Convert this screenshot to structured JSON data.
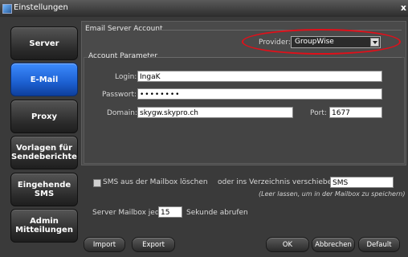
{
  "window": {
    "title": "Einstellungen",
    "close_label": "x"
  },
  "sidebar": {
    "items": [
      {
        "label": "Server"
      },
      {
        "label": "E-Mail"
      },
      {
        "label": "Proxy"
      },
      {
        "label": "Vorlagen für Sendeberichte"
      },
      {
        "label": "Eingehende SMS"
      },
      {
        "label": "Admin Mitteilungen"
      }
    ]
  },
  "email_server": {
    "group_title": "Email Server Account",
    "provider_label": "Provider:",
    "provider_value": "GroupWise",
    "highlight_color": "#e0101a"
  },
  "account": {
    "group_title": "Account Parameter",
    "login_label": "Login:",
    "login_value": "IngaK",
    "password_label": "Passwort:",
    "password_value": "••••••••",
    "domain_label": "Domain:",
    "domain_value": "skygw.skypro.ch",
    "port_label": "Port:",
    "port_value": "1677"
  },
  "options": {
    "sms_delete_label": "SMS aus der Mailbox löschen",
    "move_label": "oder ins Verzeichnis verschieben:",
    "move_value": "SMS",
    "move_hint": "(Leer lassen, um in der Mailbox zu speichern)",
    "poll_prefix": "Server Mailbox jede",
    "poll_value": "15",
    "poll_suffix": "Sekunde abrufen"
  },
  "buttons": {
    "import": "Import",
    "export": "Export",
    "ok": "OK",
    "cancel": "Abbrechen",
    "default": "Default"
  }
}
